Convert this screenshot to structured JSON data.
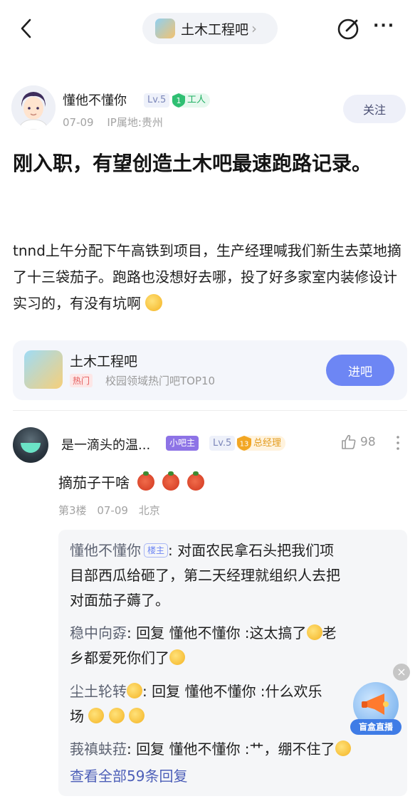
{
  "header": {
    "forum_name": "土木工程吧",
    "chevron": "›",
    "more": "···"
  },
  "author": {
    "name": "懂他不懂你",
    "level": "Lv.5",
    "rank_num": "1",
    "rank_title": "工人",
    "date": "07-09",
    "ip": "IP属地:贵州",
    "follow_label": "关注"
  },
  "post": {
    "title": "刚入职，有望创造土木吧最速跑路记录。",
    "body": "tnnd上午分配下午高铁到项目，生产经理喊我们新生去菜地摘了十三袋茄子。跑路也没想好去哪，投了好多家室内装修设计实习的，有没有坑啊"
  },
  "forum_card": {
    "name": "土木工程吧",
    "hot_tag": "热门",
    "desc": "校园领域热门吧TOP10",
    "enter_label": "进吧"
  },
  "comment": {
    "user": "是一滴头的温...",
    "mod_tag": "小吧主",
    "level": "Lv.5",
    "rank_num": "13",
    "rank_title": "总经理",
    "likes": "98",
    "text": "摘茄子干啥",
    "floor": "第3楼",
    "date": "07-09",
    "location": "北京",
    "replies": [
      {
        "user": "懂他不懂你",
        "op_tag": "楼主",
        "sep": ":",
        "line1": " 对面农民拿石头把我们项",
        "line2": "目部西瓜给砸了，第二天经理就组织人去把",
        "line3": "对面茄子薅了。"
      },
      {
        "user": "稳中向孬",
        "text1": ": 回复 懂他不懂你 :这太搞了",
        "text2": "老",
        "line2": "乡都爱死你们了"
      },
      {
        "user": "尘土轮转",
        "text1": ": 回复 懂他不懂你 :什么欢乐",
        "line2": "场"
      },
      {
        "user": "莪禛蚨菈",
        "text1": ": 回复 懂他不懂你 :艹，绷不住了"
      }
    ],
    "view_all": "查看全部59条回复"
  },
  "floating": {
    "close": "×",
    "label": "盲盒直播"
  }
}
